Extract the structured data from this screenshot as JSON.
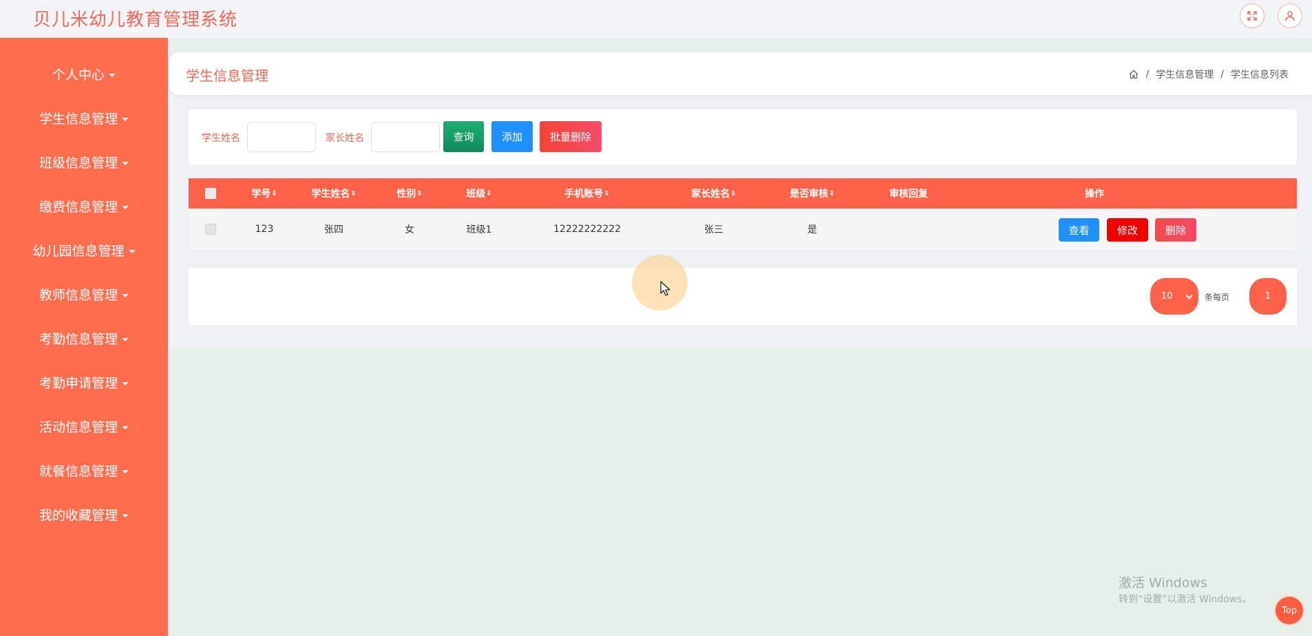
{
  "app": {
    "title": "贝儿米幼儿教育管理系统"
  },
  "header_icons": [
    "fullscreen-icon",
    "user-icon"
  ],
  "sidebar": {
    "items": [
      {
        "label": "个人中心"
      },
      {
        "label": "学生信息管理"
      },
      {
        "label": "班级信息管理"
      },
      {
        "label": "缴费信息管理"
      },
      {
        "label": "幼儿园信息管理"
      },
      {
        "label": "教师信息管理"
      },
      {
        "label": "考勤信息管理"
      },
      {
        "label": "考勤申请管理"
      },
      {
        "label": "活动信息管理"
      },
      {
        "label": "就餐信息管理"
      },
      {
        "label": "我的收藏管理"
      }
    ]
  },
  "page": {
    "title": "学生信息管理",
    "breadcrumb": {
      "separator": "/",
      "items": [
        "学生信息管理",
        "学生信息列表"
      ]
    }
  },
  "search": {
    "student_name_label": "学生姓名",
    "student_name_value": "",
    "parent_name_label": "家长姓名",
    "parent_name_value": "",
    "query_button": "查询",
    "add_button": "添加",
    "batch_delete_button": "批量删除"
  },
  "table": {
    "sort_glyph": "⇕",
    "columns": [
      "学号",
      "学生姓名",
      "性别",
      "班级",
      "手机账号",
      "家长姓名",
      "是否审核",
      "审核回复",
      "操作"
    ],
    "rows": [
      {
        "id": "123",
        "student_name": "张四",
        "gender": "女",
        "class": "班级1",
        "phone": "12222222222",
        "parent_name": "张三",
        "approved": "是",
        "reply": "",
        "actions": {
          "view": "查看",
          "edit": "修改",
          "delete": "删除"
        }
      }
    ]
  },
  "pagination": {
    "page_size": "10",
    "per_page_label": "条每页",
    "current_page": "1"
  },
  "watermark": {
    "line1": "激活 Windows",
    "line2": "转到“设置”以激活 Windows。"
  },
  "back_to_top": "Top",
  "colors": {
    "brand": "#ff6c4e",
    "accent_red": "#ff6048",
    "title_red": "#f06756",
    "query_green": "#15a36b",
    "add_blue": "#1e90ff",
    "view_blue": "#1e90ff",
    "edit_red": "#f20000",
    "delete_pink": "#f74766"
  }
}
